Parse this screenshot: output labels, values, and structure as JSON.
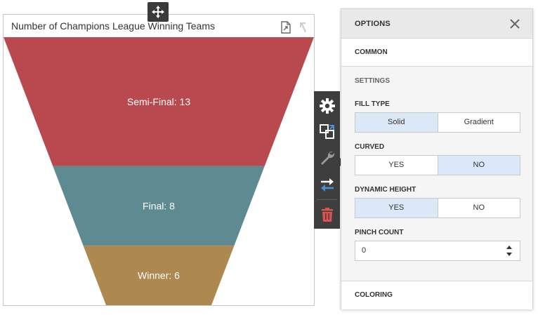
{
  "chart": {
    "title": "Number of Champions League Winning Teams",
    "export_icon": "export-icon",
    "drill_up_icon": "drill-up-icon"
  },
  "chart_data": {
    "type": "funnel",
    "categories": [
      "Semi-Final",
      "Final",
      "Winner"
    ],
    "values": [
      13,
      8,
      6
    ],
    "labels": [
      "Semi-Final: 13",
      "Final: 8",
      "Winner: 6"
    ],
    "colors": [
      "#b84a4f",
      "#5e8a91",
      "#ad884f"
    ]
  },
  "toolbar": {
    "items": [
      "gear-icon",
      "convert-icon",
      "wrench-icon",
      "swap-icon",
      "trash-icon"
    ],
    "icon_color": "#ffffff",
    "accent_color": "#4a90d9",
    "delete_color": "#d9534f"
  },
  "options": {
    "title": "OPTIONS",
    "common": "COMMON",
    "settings_title": "SETTINGS",
    "fill_type": {
      "label": "FILL TYPE",
      "options": [
        "Solid",
        "Gradient"
      ],
      "selected": "Solid"
    },
    "curved": {
      "label": "CURVED",
      "options": [
        "YES",
        "NO"
      ],
      "selected": "NO"
    },
    "dynamic_height": {
      "label": "DYNAMIC HEIGHT",
      "options": [
        "YES",
        "NO"
      ],
      "selected": "YES"
    },
    "pinch_count": {
      "label": "PINCH COUNT",
      "value": "0"
    },
    "coloring": "COLORING"
  }
}
